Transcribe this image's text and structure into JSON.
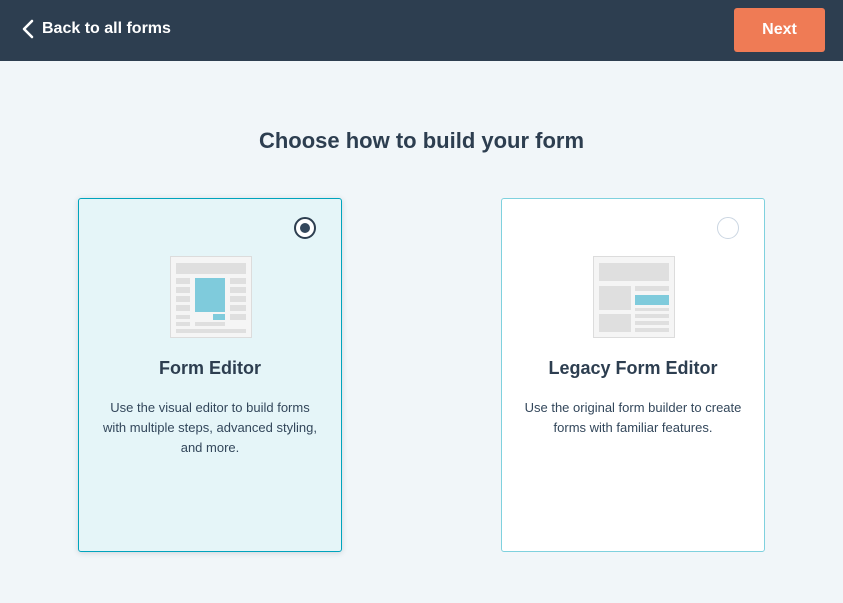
{
  "topbar": {
    "back_label": "Back to all forms",
    "next_label": "Next"
  },
  "page": {
    "title": "Choose how to build your form"
  },
  "options": [
    {
      "title": "Form Editor",
      "description": "Use the visual editor to build forms with multiple steps, advanced styling, and more.",
      "selected": true
    },
    {
      "title": "Legacy Form Editor",
      "description": "Use the original form builder to create forms with familiar features.",
      "selected": false
    }
  ],
  "colors": {
    "header_bg": "#2d3e50",
    "accent_orange": "#ef7b55",
    "page_bg": "#f1f6f9",
    "selected_card_bg": "#e5f5f8",
    "selected_border": "#00a4bd",
    "illustration_blue": "#7fcbdc"
  }
}
